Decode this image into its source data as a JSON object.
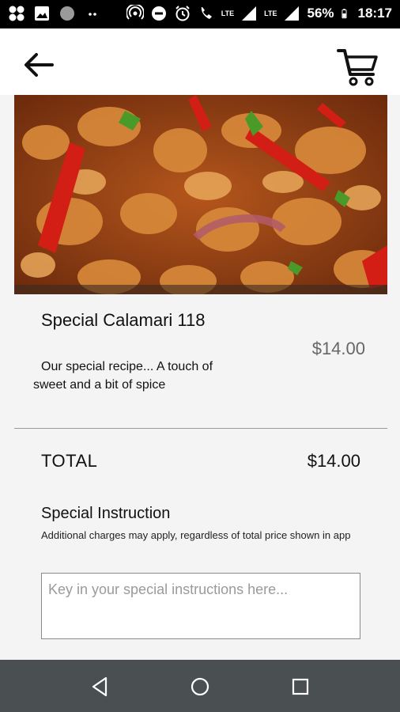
{
  "status_bar": {
    "battery": "56%",
    "time": "18:17",
    "lte_1": "LTE",
    "lte_2": "LTE"
  },
  "app_bar": {
    "back_icon": "arrow-left-icon",
    "cart_icon": "shopping-cart-icon"
  },
  "item": {
    "name": "Special Calamari 118",
    "price": "$14.00",
    "description": "Our special recipe... A touch of sweet and a bit of spice"
  },
  "total": {
    "label": "TOTAL",
    "value": "$14.00"
  },
  "instructions": {
    "title": "Special Instruction",
    "note": "Additional charges may apply, regardless of total price shown in app",
    "placeholder": "Key in your special instructions here..."
  },
  "nav": {
    "back": "triangle-back-icon",
    "home": "circle-home-icon",
    "recents": "square-recents-icon"
  },
  "colors": {
    "status_bar_bg": "#000000",
    "app_bar_bg": "#ffffff",
    "page_bg": "#f4f4f4",
    "nav_bar_bg": "#4a4f52",
    "price_muted": "#666666"
  }
}
